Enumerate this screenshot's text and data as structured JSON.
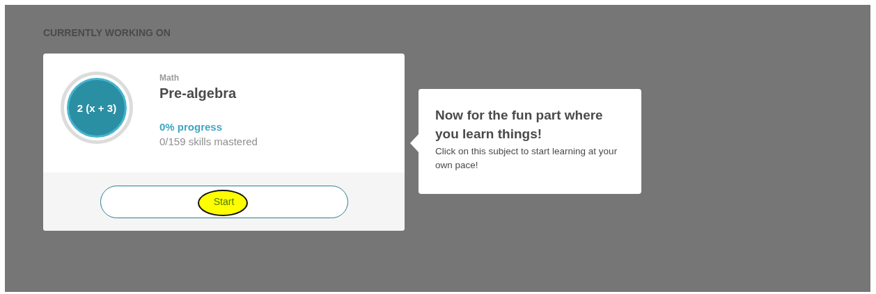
{
  "section_heading": "CURRENTLY WORKING ON",
  "course_card": {
    "icon_text": "2 (x + 3)",
    "subject": "Math",
    "title": "Pre-algebra",
    "progress": "0% progress",
    "skills": "0/159 skills mastered",
    "button": "Start",
    "button_highlighted": true
  },
  "tooltip": {
    "title": "Now for the fun part where you learn things!",
    "body": "Click on this subject to start learning at your own pace!"
  }
}
